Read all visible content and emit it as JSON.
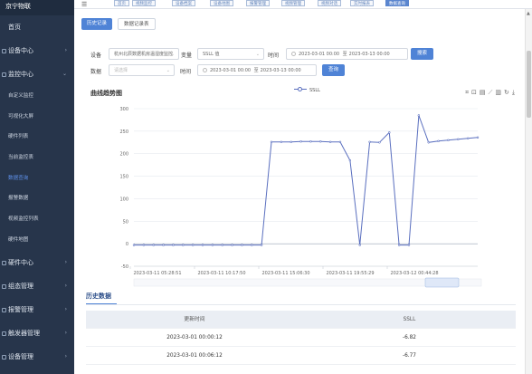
{
  "sidebar": {
    "brand": "京宁物联",
    "items": [
      {
        "label": "首页",
        "type": "item",
        "arrow": ""
      },
      {
        "label": "设备中心",
        "type": "item",
        "arrow": "›"
      },
      {
        "label": "监控中心",
        "type": "item",
        "arrow": "⌄"
      },
      {
        "label": "自定义监控",
        "type": "sub"
      },
      {
        "label": "可视化大屏",
        "type": "sub"
      },
      {
        "label": "硬件列表",
        "type": "sub"
      },
      {
        "label": "当前监控表",
        "type": "sub"
      },
      {
        "label": "数据查询",
        "type": "sub",
        "active": true
      },
      {
        "label": "报警数据",
        "type": "sub"
      },
      {
        "label": "视频监控列表",
        "type": "sub"
      },
      {
        "label": "硬件地图",
        "type": "sub"
      },
      {
        "label": "硬件中心",
        "type": "item",
        "arrow": "›"
      },
      {
        "label": "组态管理",
        "type": "item",
        "arrow": "›"
      },
      {
        "label": "报警管理",
        "type": "item",
        "arrow": "›"
      },
      {
        "label": "触发器管理",
        "type": "item",
        "arrow": "›"
      },
      {
        "label": "设备管理",
        "type": "item",
        "arrow": "›"
      },
      {
        "label": "运维管理",
        "type": "item",
        "arrow": "›"
      }
    ]
  },
  "topbar": {
    "tabs": [
      "首页",
      "视频监控",
      "设备档案",
      "设备地图",
      "报警管理",
      "视频管理",
      "视频对话",
      "实时报表",
      "数据查询"
    ],
    "active_tab": 8
  },
  "toolbar": {
    "history_button": "历史记录",
    "export_button": "数据记录表"
  },
  "filters": {
    "device_label": "设备",
    "device_value": "杭州北辰数据机房温湿度监控",
    "variable_label": "变量",
    "variable_value": "SSLL 值",
    "time_label": "时间",
    "time_start": "2023-03-01 00:00",
    "time_sep": "至",
    "time_end": "2023-03-13 00:00",
    "search_button": "搜索",
    "data_label": "数据",
    "data_placeholder": "请选择",
    "time2_label": "时间",
    "time2_start": "2023-03-01 00:00",
    "time2_end": "2023-03-13 00:00",
    "query_button": "查询"
  },
  "chart_section": {
    "title": "曲线趋势图",
    "tools": [
      "crop-icon",
      "restore-crop-icon",
      "data-view-icon",
      "line-chart-icon",
      "bar-chart-icon",
      "restore-icon",
      "download-icon"
    ]
  },
  "chart_data": {
    "type": "line",
    "series": [
      {
        "name": "SSLL",
        "color": "#5a6fbf",
        "values": [
          -3,
          -3,
          -3,
          -3,
          -3,
          -3,
          -3,
          -3,
          -3,
          -3,
          -3,
          -3,
          -3,
          -3,
          226,
          226,
          226,
          227,
          227,
          227,
          226,
          226,
          185,
          -3,
          226,
          225,
          247,
          -3,
          -3,
          285,
          225,
          228,
          230,
          232,
          234,
          236
        ]
      }
    ],
    "ylim": [
      -50,
      300
    ],
    "yticks": [
      -50,
      0,
      50,
      100,
      150,
      200,
      250,
      300
    ],
    "x_labels": [
      "2023-03-11 05:28:51",
      "2023-03-11 10:17:50",
      "2023-03-11 15:06:30",
      "2023-03-11 19:55:29",
      "2023-03-12 00:44:28"
    ],
    "grid": true,
    "legend": "top"
  },
  "history": {
    "title": "历史数据",
    "columns": [
      "更新时间",
      "SSLL"
    ],
    "rows": [
      [
        "2023-03-01 00:00:12",
        "-6.82"
      ],
      [
        "2023-03-01 00:06:12",
        "-6.77"
      ]
    ]
  }
}
